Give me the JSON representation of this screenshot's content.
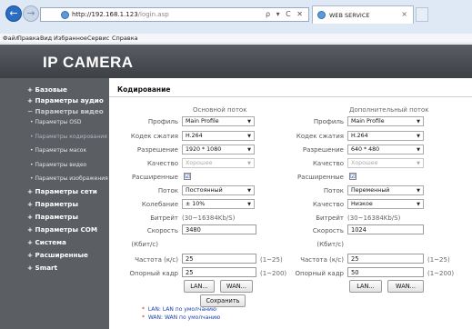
{
  "browser": {
    "url_host": "http://192.168.1.123",
    "url_path": "/login.asp",
    "search_controls": "ρ ▾ C ✕",
    "tab_title": "WEB SERVICE",
    "menu": [
      "Файл",
      "Правка",
      "Вид",
      "Избранное",
      "Сервис",
      "Справка"
    ]
  },
  "brand": "IP CAMERA",
  "sidebar": [
    {
      "label": "+ Базовые"
    },
    {
      "label": "+ Параметры аудио"
    },
    {
      "label": "− Параметры видео"
    },
    {
      "label": "• Параметры OSD"
    },
    {
      "label": "• Параметры кодирования"
    },
    {
      "label": "• Параметры масок"
    },
    {
      "label": "• Параметры видео"
    },
    {
      "label": "• Параметры изображения"
    },
    {
      "label": "+ Параметры сети"
    },
    {
      "label": "+ Параметры"
    },
    {
      "label": "+ Параметры"
    },
    {
      "label": "+ Параметры COM"
    },
    {
      "label": "+ Система"
    },
    {
      "label": "+ Расширенные"
    },
    {
      "label": "+ Smart"
    }
  ],
  "tab": "Кодирование",
  "main_stream": {
    "title": "Основной поток",
    "profile_label": "Профиль",
    "profile": "Main Profile",
    "codec_label": "Кодек сжатия",
    "codec": "H.264",
    "resolution_label": "Разрешение",
    "resolution": "1920 * 1080",
    "quality_label": "Качество",
    "quality": "Хорошее",
    "advanced_label": "Расширенные",
    "advanced_mark": "☑",
    "stream_label": "Поток",
    "stream": "Постоянный",
    "fluctuation_label": "Колебание",
    "fluctuation": "± 10%",
    "bitrate_label": "Битрейт",
    "bitrate_range": "(30~16384Kb/S)",
    "speed_label": "Скорость",
    "speed_value": "3480",
    "speed_unit": "(Кбит/с)",
    "fps_label": "Частота (к/с)",
    "fps_value": "25",
    "fps_range": "(1~25)",
    "gop_label": "Опорный кадр",
    "gop_value": "25",
    "gop_range": "(1~200)",
    "lan_button": "LAN...",
    "wan_button": "WAN..."
  },
  "sub_stream": {
    "title": "Дополнительный поток",
    "profile_label": "Профиль",
    "profile": "Main Profile",
    "codec_label": "Кодек сжатия",
    "codec": "H.264",
    "resolution_label": "Разрешение",
    "resolution": "640 * 480",
    "quality_label": "Качество",
    "quality": "Хорошее",
    "advanced_label": "Расширенные",
    "advanced_mark": "☑",
    "stream_label": "Поток",
    "stream": "Переменный",
    "quality2_label": "Качество",
    "quality2": "Низкое",
    "bitrate_label": "Битрейт",
    "bitrate_range": "(30~16384Kb/S)",
    "speed_label": "Скорость",
    "speed_value": "1024",
    "speed_unit": "(Кбит/с)",
    "fps_label": "Частота (к/с)",
    "fps_value": "25",
    "fps_range": "(1~25)",
    "gop_label": "Опорный кадр",
    "gop_value": "50",
    "gop_range": "(1~200)",
    "lan_button": "LAN...",
    "wan_button": "WAN..."
  },
  "save_button": "Сохранить",
  "notes": [
    {
      "star": "*",
      "text": "LAN: LAN по умолчанию"
    },
    {
      "star": "*",
      "text": "WAN: WAN по умолчанию"
    }
  ]
}
